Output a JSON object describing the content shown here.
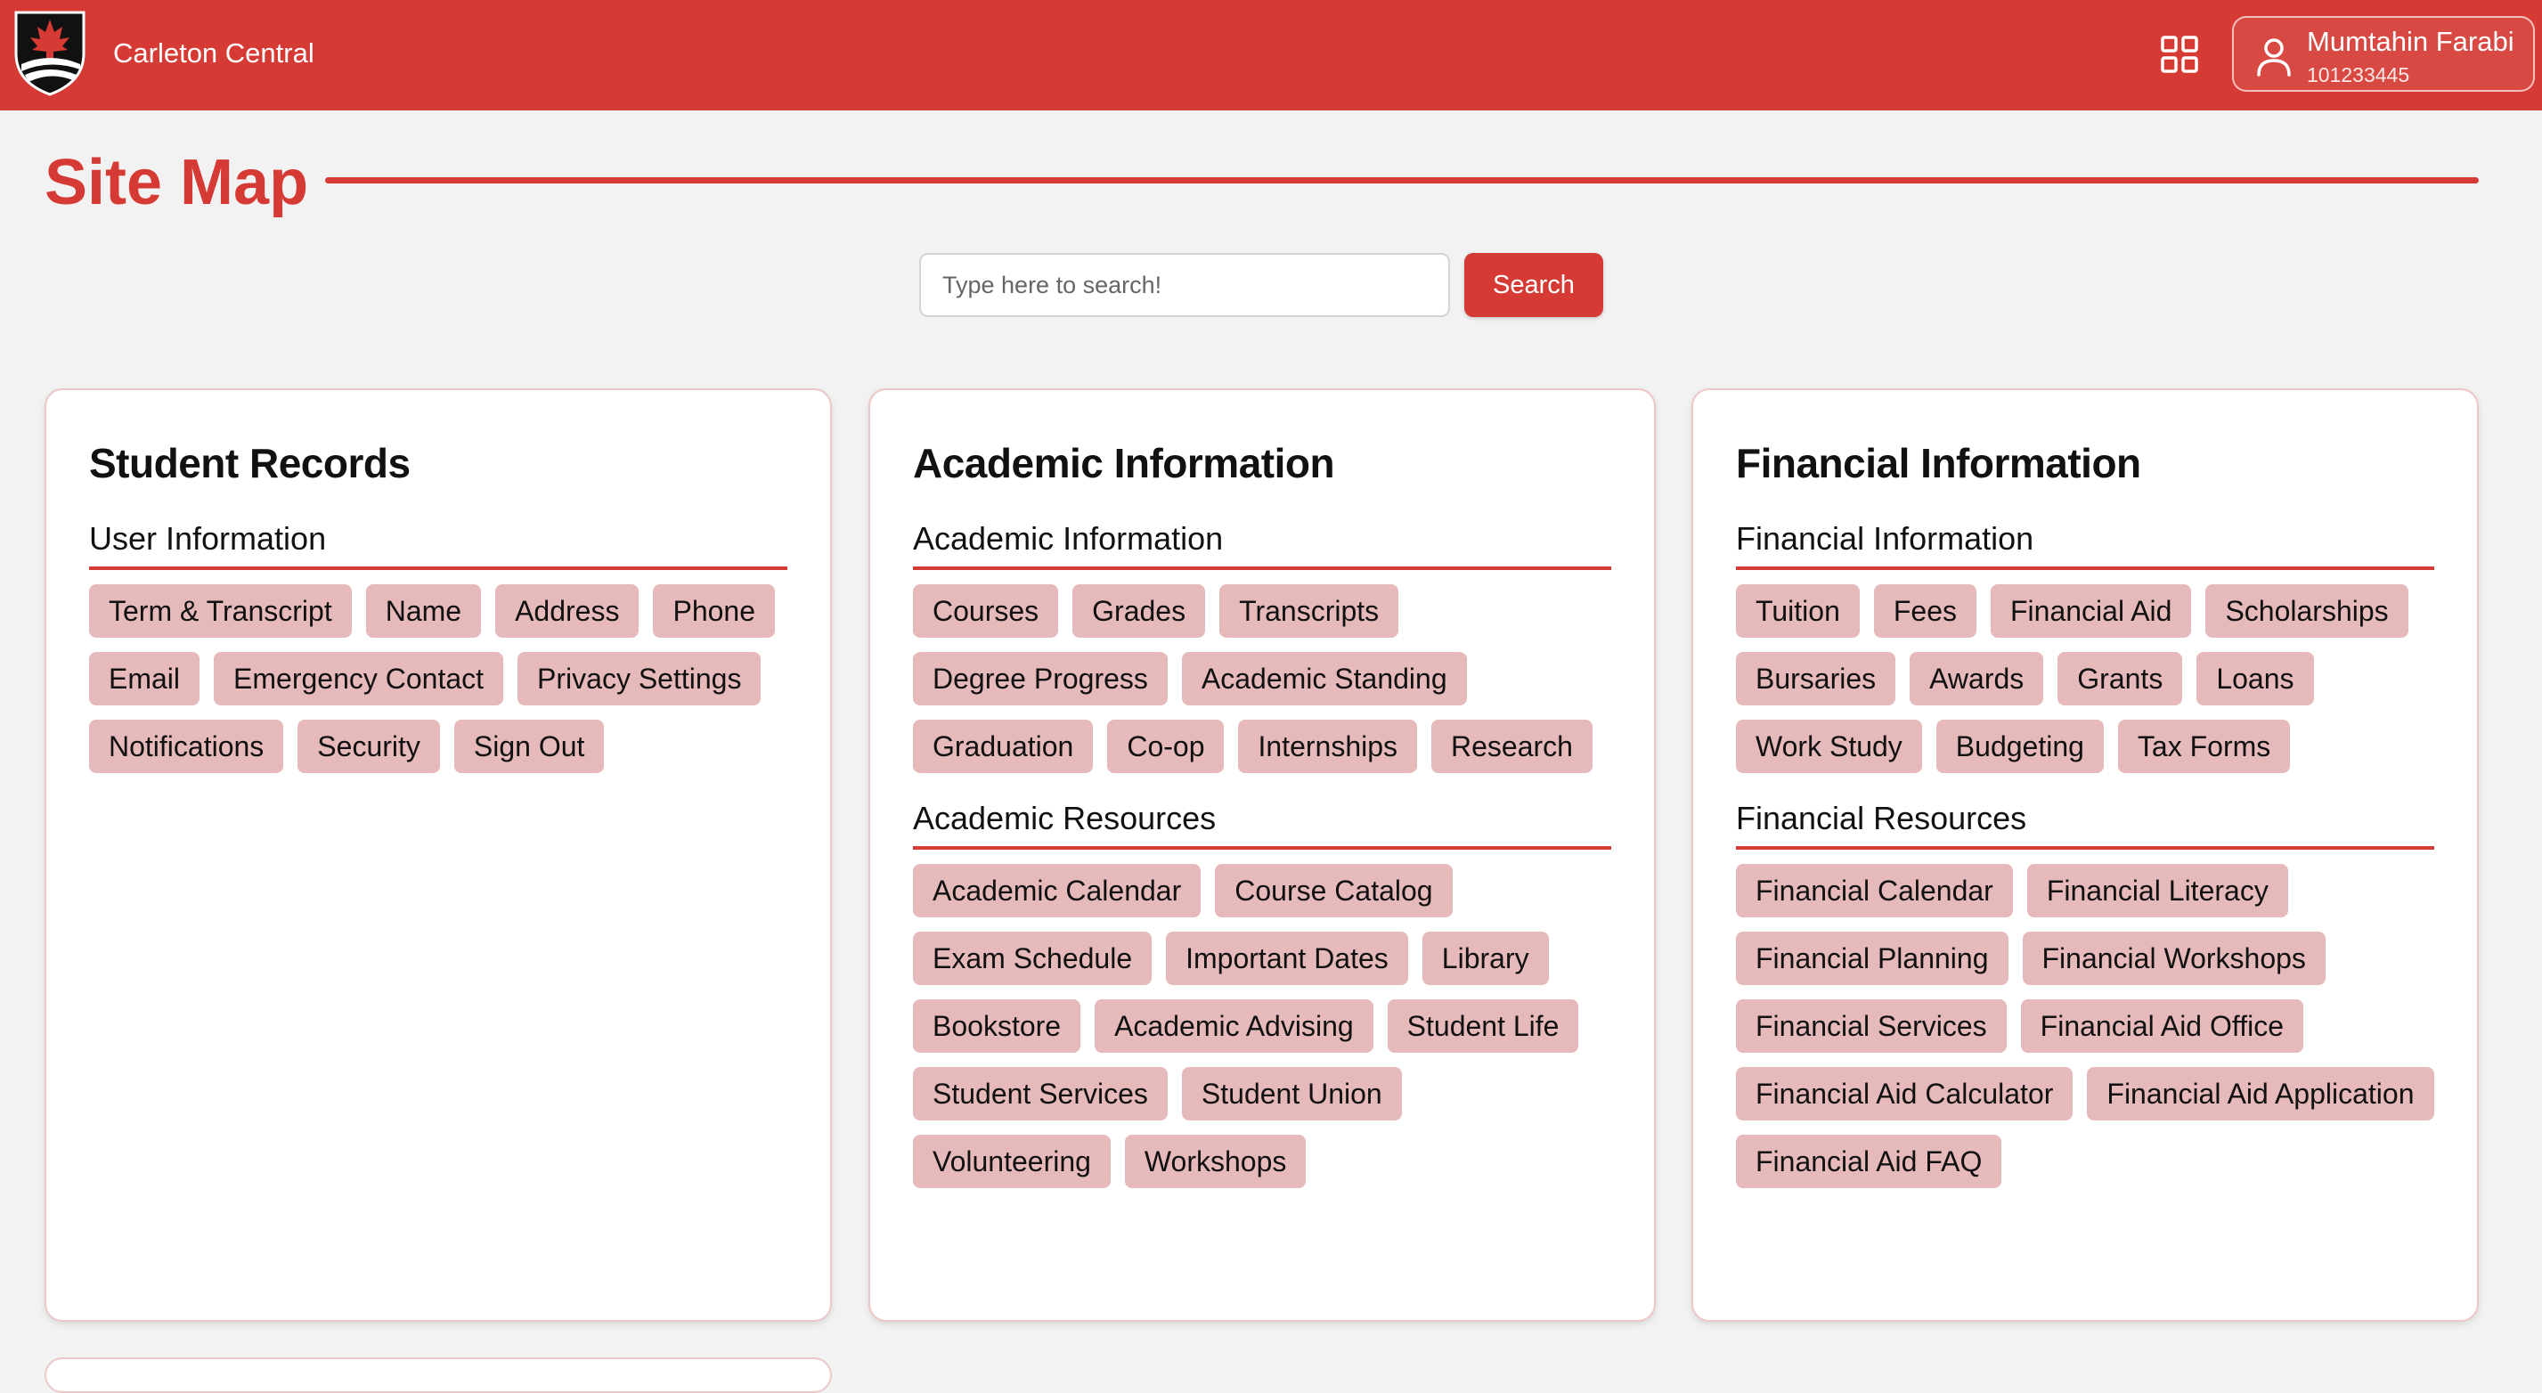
{
  "header": {
    "app_title": "Carleton Central",
    "user": {
      "name": "Mumtahin Farabi",
      "id": "101233445"
    }
  },
  "page": {
    "title": "Site Map"
  },
  "search": {
    "placeholder": "Type here to search!",
    "value": "",
    "button_label": "Search"
  },
  "colors": {
    "accent": "#d63a34",
    "chip_bg": "#e6b9bb",
    "background": "#f2f2f2"
  },
  "cards": [
    {
      "title": "Student Records",
      "sections": [
        {
          "title": "User Information",
          "items": [
            "Term & Transcript",
            "Name",
            "Address",
            "Phone",
            "Email",
            "Emergency Contact",
            "Privacy Settings",
            "Notifications",
            "Security",
            "Sign Out"
          ]
        }
      ]
    },
    {
      "title": "Academic Information",
      "sections": [
        {
          "title": "Academic Information",
          "items": [
            "Courses",
            "Grades",
            "Transcripts",
            "Degree Progress",
            "Academic Standing",
            "Graduation",
            "Co-op",
            "Internships",
            "Research"
          ]
        },
        {
          "title": "Academic Resources",
          "items": [
            "Academic Calendar",
            "Course Catalog",
            "Exam Schedule",
            "Important Dates",
            "Library",
            "Bookstore",
            "Academic Advising",
            "Student Life",
            "Student Services",
            "Student Union",
            "Volunteering",
            "Workshops"
          ]
        }
      ]
    },
    {
      "title": "Financial Information",
      "sections": [
        {
          "title": "Financial Information",
          "items": [
            "Tuition",
            "Fees",
            "Financial Aid",
            "Scholarships",
            "Bursaries",
            "Awards",
            "Grants",
            "Loans",
            "Work Study",
            "Budgeting",
            "Tax Forms"
          ]
        },
        {
          "title": "Financial Resources",
          "items": [
            "Financial Calendar",
            "Financial Literacy",
            "Financial Planning",
            "Financial Workshops",
            "Financial Services",
            "Financial Aid Office",
            "Financial Aid Calculator",
            "Financial Aid Application",
            "Financial Aid FAQ"
          ]
        }
      ]
    }
  ]
}
